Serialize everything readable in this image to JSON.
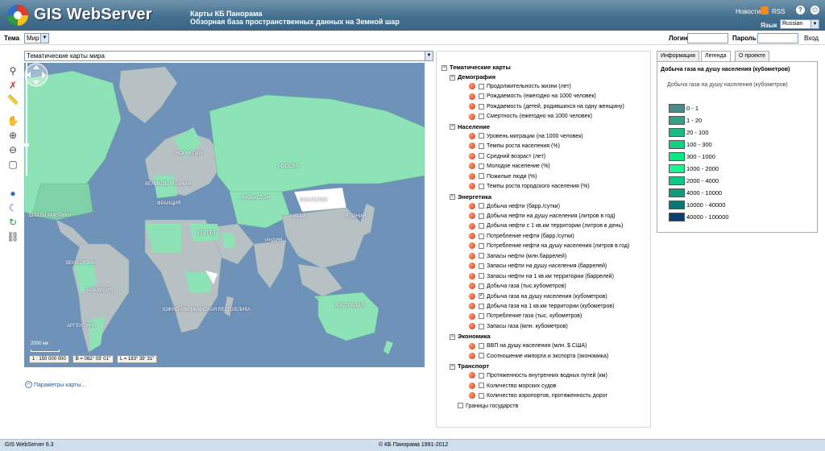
{
  "header": {
    "logo_text": "GIS WebServer",
    "title_line1": "Карты КБ Панорама",
    "title_line2": "Обзорная база пространственных данных на Земной шар",
    "news_link": "Новости",
    "rss_link": "RSS",
    "language_label": "Язык",
    "language_value": "Russian"
  },
  "toolbar": {
    "theme_label": "Тема",
    "theme_value": "Мир",
    "login_label": "Логин",
    "password_label": "Пароль",
    "enter_link": "Вход"
  },
  "left_tools": [
    "binoculars-icon",
    "no-edit-icon",
    "ruler-icon",
    "pan-hand-icon",
    "zoom-in-icon",
    "zoom-out-icon",
    "select-rect-icon",
    "globe-icon",
    "moon-icon",
    "refresh-icon",
    "link-icon"
  ],
  "map": {
    "select_value": "Тематические карты мира",
    "labels": {
      "norway": "НОРВЕГИЯ",
      "russia": "РОССИЯ",
      "uk": "ВЕЛИКОБРИТАНИЯ",
      "kazakhstan": "КАЗАХСТАН",
      "france": "ФРАНЦИЯ",
      "mongolia": "МОНГОЛИЯ",
      "china": "КИТАЙ",
      "japan": "ЯПОНИЯ",
      "egypt": "ЕГИПЕТ",
      "india": "ИНДИЯ",
      "usa": "ШТАТЫ АМЕРИКИ",
      "venezuela": "ВЕНЕСУЭЛА",
      "brazil": "БРАЗИЛИЯ",
      "south_africa": "ЮЖНО-АФРИКАНСКАЯ РЕСПУБЛИКА",
      "australia": "АВСТРАЛИЯ",
      "argentina": "АРГЕНТИНА"
    },
    "scale_text": "2000 км",
    "scale_ratio": "1 : 150 000 000",
    "coord_b": "B = 082° 03' 01\"",
    "coord_l": "L = 183° 39' 31\"",
    "params_link": "Параметры карты..."
  },
  "layers": {
    "root": "Тематические карты",
    "groups": [
      {
        "name": "Демография",
        "items": [
          {
            "label": "Продолжительность жизни (лет)",
            "checked": false
          },
          {
            "label": "Рождаемость (ежегодно на 1000 человек)",
            "checked": false
          },
          {
            "label": "Рождаемость (детей, родившихся на одну женщину)",
            "checked": false
          },
          {
            "label": "Смертность (ежегодно на 1000 человек)",
            "checked": false
          }
        ]
      },
      {
        "name": "Население",
        "items": [
          {
            "label": "Уровень миграции (на 1000 человек)",
            "checked": false
          },
          {
            "label": "Темпы роста населения (%)",
            "checked": false
          },
          {
            "label": "Средний возраст (лет)",
            "checked": false
          },
          {
            "label": "Молодое население (%)",
            "checked": false
          },
          {
            "label": "Пожилые люди (%)",
            "checked": false
          },
          {
            "label": "Темпы роста городского населения (%)",
            "checked": false
          }
        ]
      },
      {
        "name": "Энергетика",
        "items": [
          {
            "label": "Добыча нефти (барр./сутки)",
            "checked": false
          },
          {
            "label": "Добыча нефти на душу населения (литров в год)",
            "checked": false
          },
          {
            "label": "Добыча нефти с 1 кв.км территории (литров в день)",
            "checked": false
          },
          {
            "label": "Потребление нефти (барр./сутки)",
            "checked": false
          },
          {
            "label": "Потребление нефти на душу населения (литров в год)",
            "checked": false
          },
          {
            "label": "Запасы нефти (млн.баррелей)",
            "checked": false
          },
          {
            "label": "Запасы нефти на душу населения (баррелей)",
            "checked": false
          },
          {
            "label": "Запасы нефти на 1 кв.км территории (баррелей)",
            "checked": false
          },
          {
            "label": "Добыча газа (тыс.кубометров)",
            "checked": false
          },
          {
            "label": "Добыча газа на душу населения (кубометров)",
            "checked": true
          },
          {
            "label": "Добыча газа на 1 кв.км территории (кубометров)",
            "checked": false
          },
          {
            "label": "Потребление газа (тыс. кубометров)",
            "checked": false
          },
          {
            "label": "Запасы газа (млн. кубометров)",
            "checked": false
          }
        ]
      },
      {
        "name": "Экономика",
        "items": [
          {
            "label": "ВВП на душу населения (млн. $ США)",
            "checked": false
          },
          {
            "label": "Соотношение импорта и экспорта (экономика)",
            "checked": false
          }
        ]
      },
      {
        "name": "Транспорт",
        "items": [
          {
            "label": "Протяженность внутренних водных путей (км)",
            "checked": false
          },
          {
            "label": "Количество морских судов",
            "checked": false
          },
          {
            "label": "Количество аэропортов, протяженность дорог",
            "checked": false
          }
        ]
      }
    ],
    "borders_label": "Границы государств"
  },
  "right_panel": {
    "tabs": [
      "Информация",
      "Легенда",
      "О проекте"
    ],
    "active_tab": "Легенда",
    "legend_title": "Добыча газа на душу населения (кубометров)",
    "legend_subtitle": "Добыча газа на душу населения (кубометров)",
    "legend": [
      {
        "label": "0 - 1",
        "color": "#4f8a8b"
      },
      {
        "label": "1 - 20",
        "color": "#35a08a"
      },
      {
        "label": "20 - 100",
        "color": "#20b886"
      },
      {
        "label": "100 - 300",
        "color": "#15d084"
      },
      {
        "label": "300 - 1000",
        "color": "#0fe487"
      },
      {
        "label": "1000 - 2000",
        "color": "#18f596"
      },
      {
        "label": "2000 - 4000",
        "color": "#14c58a"
      },
      {
        "label": "4000 - 10000",
        "color": "#119b7c"
      },
      {
        "label": "10000 - 40000",
        "color": "#0d746f"
      },
      {
        "label": "40000 - 100000",
        "color": "#0a3f72"
      }
    ]
  },
  "footer": {
    "version": "GIS WebServer 6.3",
    "copyright": "© КБ Панорама 1991-2012"
  },
  "colors": {
    "header_bg": "#44708f",
    "ocean": "#6f92b9",
    "land_gray": "#b7c1c4",
    "land_green": "#8de2b6",
    "link": "#1c5ea8"
  }
}
